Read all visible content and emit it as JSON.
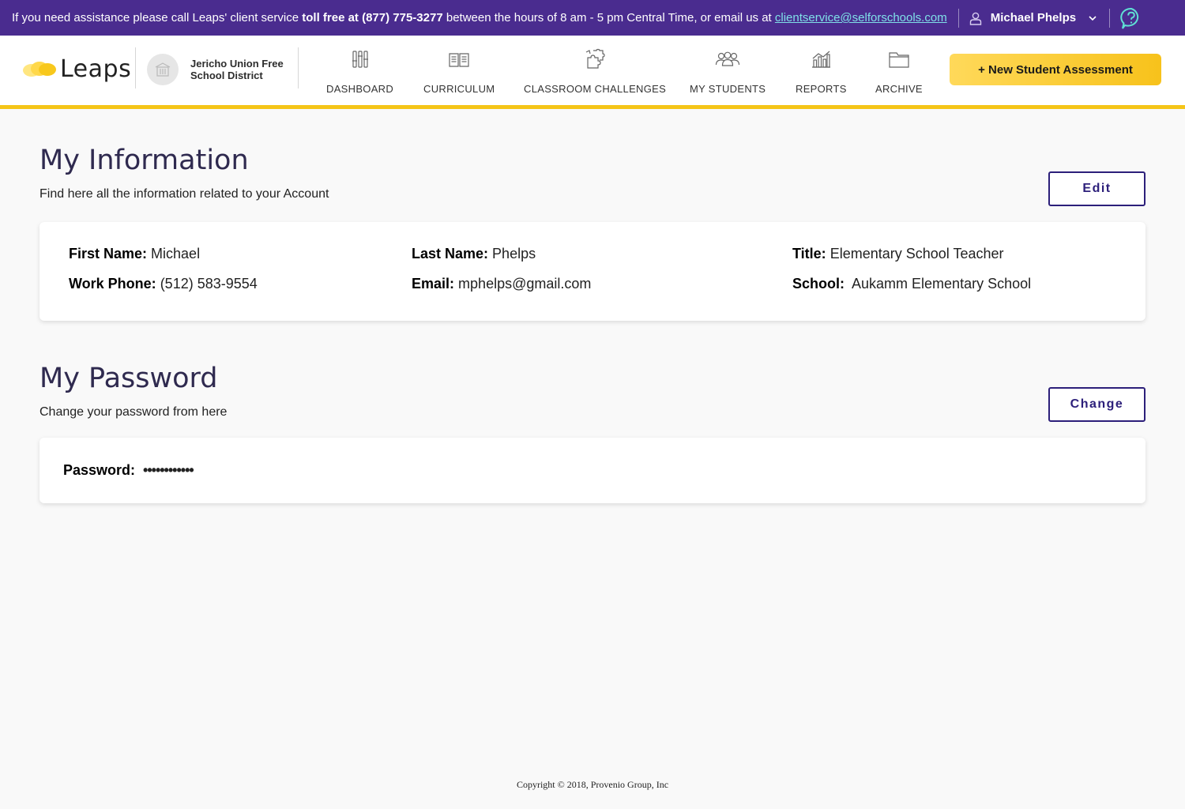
{
  "topbar": {
    "msg_start": "If you need assistance please call Leaps' client service ",
    "msg_bold": "toll free at (877) 775-3277",
    "msg_mid": " between the hours of 8 am - 5 pm Central Time, or email us at ",
    "email": "clientservice@selforschools.com",
    "user_name": "Michael Phelps",
    "user_icon": "user-icon",
    "help_icon": "help-icon"
  },
  "header": {
    "logo_text": "Leaps",
    "district_name": "Jericho Union Free School District",
    "nav": [
      {
        "label": "DASHBOARD",
        "icon": "sliders-icon"
      },
      {
        "label": "CURRICULUM",
        "icon": "book-icon"
      },
      {
        "label": "CLASSROOM CHALLENGES",
        "icon": "puzzle-icon"
      },
      {
        "label": "MY STUDENTS",
        "icon": "students-icon"
      },
      {
        "label": "REPORTS",
        "icon": "chart-icon"
      },
      {
        "label": "ARCHIVE",
        "icon": "folder-icon"
      }
    ],
    "new_assessment_label": "+ New Student Assessment"
  },
  "info": {
    "title": "My Information",
    "subtitle": "Find here all the information related to your Account",
    "edit_label": "Edit",
    "fields": {
      "first_name_label": "First Name:",
      "first_name": "Michael",
      "last_name_label": "Last Name:",
      "last_name": "Phelps",
      "title_label": "Title:",
      "title": "Elementary School Teacher",
      "phone_label": "Work Phone:",
      "phone": "(512) 583-9554",
      "email_label": "Email:",
      "email": "mphelps@gmail.com",
      "school_label": "School:",
      "school": "Aukamm Elementary School"
    }
  },
  "password": {
    "title": "My Password",
    "subtitle": "Change your password from here",
    "change_label": "Change",
    "label": "Password:",
    "value": "••••••••••••"
  },
  "footer": {
    "copyright": "Copyright © 2018, Provenio Group, Inc"
  },
  "colors": {
    "topbar_bg": "#4a2c8f",
    "accent_yellow": "#f5c518",
    "button_border": "#2c1f7a",
    "link": "#7fe0e8"
  }
}
